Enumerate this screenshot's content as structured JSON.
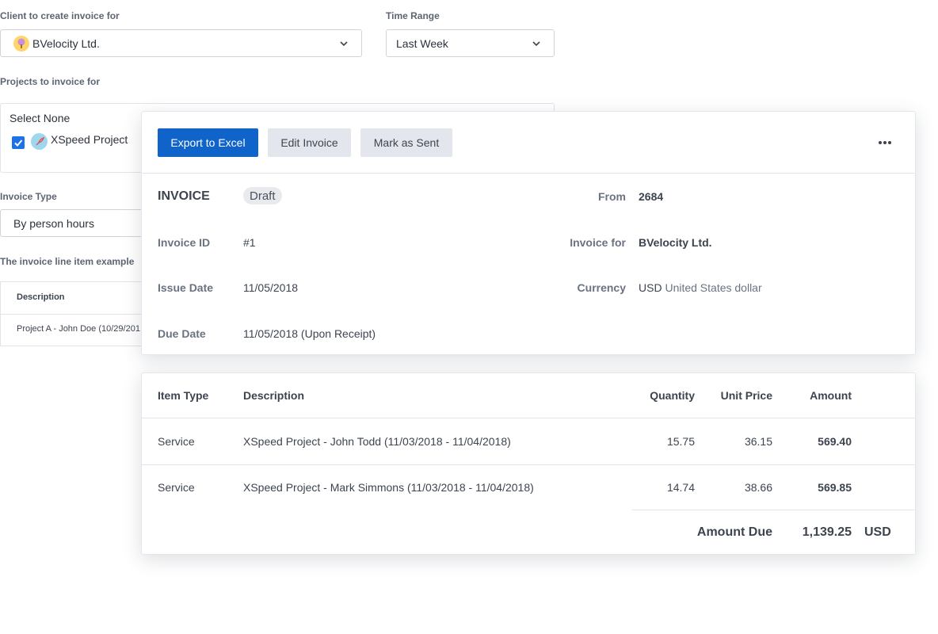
{
  "form": {
    "client_label": "Client to create invoice for",
    "client_value": "BVelocity Ltd.",
    "time_range_label": "Time Range",
    "time_range_value": "Last Week",
    "projects_label": "Projects to invoice for",
    "select_none": "Select None",
    "project_name": "XSpeed Project",
    "project_checked": true,
    "invoice_type_label": "Invoice Type",
    "invoice_type_value": "By person hours",
    "line_item_example_label": "The invoice line item example",
    "example_header": "Description",
    "example_row": "Project A - John Doe (10/29/201"
  },
  "toolbar": {
    "export_label": "Export to Excel",
    "edit_label": "Edit Invoice",
    "mark_sent_label": "Mark as Sent"
  },
  "invoice": {
    "title": "INVOICE",
    "status": "Draft",
    "id_label": "Invoice ID",
    "id_value": "#1",
    "issue_date_label": "Issue Date",
    "issue_date_value": "11/05/2018",
    "due_date_label": "Due Date",
    "due_date_value": "11/05/2018 (Upon Receipt)",
    "from_label": "From",
    "from_value": "2684",
    "invoice_for_label": "Invoice for",
    "invoice_for_value": "BVelocity Ltd.",
    "currency_label": "Currency",
    "currency_code": "USD",
    "currency_name": "United States dollar"
  },
  "items": {
    "headers": {
      "item_type": "Item Type",
      "description": "Description",
      "quantity": "Quantity",
      "unit_price": "Unit Price",
      "amount": "Amount"
    },
    "rows": [
      {
        "item_type": "Service",
        "description": "XSpeed Project - John Todd (11/03/2018 - 11/04/2018)",
        "quantity": "15.75",
        "unit_price": "36.15",
        "amount": "569.40"
      },
      {
        "item_type": "Service",
        "description": "XSpeed Project - Mark Simmons (11/03/2018 - 11/04/2018)",
        "quantity": "14.74",
        "unit_price": "38.66",
        "amount": "569.85"
      }
    ],
    "amount_due_label": "Amount Due",
    "amount_due_value": "1,139.25",
    "amount_due_currency": "USD"
  },
  "colors": {
    "primary": "#0f63c9",
    "secondary_button": "#e3e7ed",
    "checkbox": "#1a73e8",
    "client_avatar": "#ffd667",
    "project_avatar": "#9fd7ef"
  },
  "icons": {
    "client": "tree-icon",
    "project": "rocket-icon",
    "dropdown": "chevron-down-icon",
    "more": "more-horizontal-icon",
    "check": "check-icon"
  }
}
